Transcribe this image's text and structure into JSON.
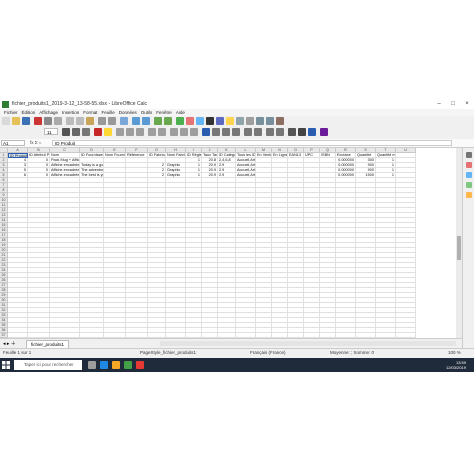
{
  "window": {
    "title": "fichier_produits1_2019-3-12_13-58-55.xlsx - LibreOffice Calc",
    "minimize": "–",
    "maximize": "□",
    "close": "×"
  },
  "menu": [
    "Fichier",
    "Édition",
    "Affichage",
    "Insertion",
    "Format",
    "Feuille",
    "Données",
    "Outils",
    "Fenêtre",
    "Aide"
  ],
  "toolbar": {
    "font_name": "Calibri",
    "font_size": "11"
  },
  "formula_bar": {
    "cell_ref": "A1",
    "fx": "fx Σ =",
    "content": "ID Produit"
  },
  "columns": [
    "A",
    "B",
    "C",
    "D",
    "E",
    "F",
    "G",
    "H",
    "I",
    "J",
    "K",
    "L",
    "M",
    "N",
    "O",
    "P",
    "Q",
    "R",
    "S",
    "T",
    "U"
  ],
  "rows": {
    "header": [
      "ID Produit",
      "ID Attribut Produit",
      "Nom",
      "ID Fournisseur",
      "Nom Fournisseur",
      "Référence",
      "ID Fabricant",
      "Nom Fabricant",
      "ID Règle",
      "Taux Taxe",
      "ID Catégorie",
      "Tous les ID",
      "En Vente",
      "En Ligne",
      "EAN13",
      "UPC",
      "ISBN",
      "Ecotaxe",
      "Quantité",
      "Quantité min"
    ],
    "data": [
      [
        "4",
        "0",
        "Pack Mug + Affiche encadrée",
        "",
        "",
        "",
        "",
        "",
        "1",
        "20.8",
        "2,4,6,8",
        "Accueil,Art",
        "",
        "",
        "",
        "",
        "",
        "0.000000",
        "300",
        "1"
      ],
      [
        "3",
        "0",
        "Affiche encadrée",
        "Today is a good day",
        "",
        "",
        "2",
        "Graphic",
        "1",
        "20.9",
        "2.9",
        "Accueil,Art",
        "",
        "",
        "",
        "",
        "",
        "0.000000",
        "900",
        "1"
      ],
      [
        "5",
        "0",
        "Affiche encadrée",
        "The adventure begins",
        "",
        "",
        "2",
        "Graphic",
        "1",
        "20.9",
        "2.9",
        "Accueil,Art",
        "",
        "",
        "",
        "",
        "",
        "0.000000",
        "900",
        "1"
      ],
      [
        "6",
        "0",
        "Affiche encadrée",
        "The best is yet to come",
        "",
        "",
        "2",
        "Graphic",
        "1",
        "20.9",
        "2.9",
        "Accueil,Art",
        "",
        "",
        "",
        "",
        "",
        "0.000000",
        "1500",
        "1"
      ]
    ],
    "row_numbers": [
      "1",
      "2",
      "3",
      "4",
      "5",
      "6",
      "7",
      "8",
      "9",
      "10",
      "11",
      "12",
      "13",
      "14",
      "15",
      "16",
      "17",
      "18",
      "19",
      "20",
      "21",
      "22",
      "23",
      "24",
      "25",
      "26",
      "27",
      "28",
      "29",
      "30",
      "31",
      "32",
      "33",
      "34",
      "35",
      "36",
      "37"
    ]
  },
  "sheet_tab": "fichier_produits1",
  "status": {
    "sheet": "Feuille 1 sur 1",
    "style": "PageStyle_fichier_produits1",
    "lang": "Français (France)",
    "stats": "Moyenne: ; Somme: 0",
    "zoom": "100 %"
  },
  "taskbar": {
    "search_placeholder": "Taper ici pour rechercher",
    "time": "13:59",
    "date": "12/03/2019"
  },
  "colors": {
    "accent": "#2a5db0",
    "taskbar": "#1f2a3a",
    "calc_green": "#2e7d32"
  }
}
